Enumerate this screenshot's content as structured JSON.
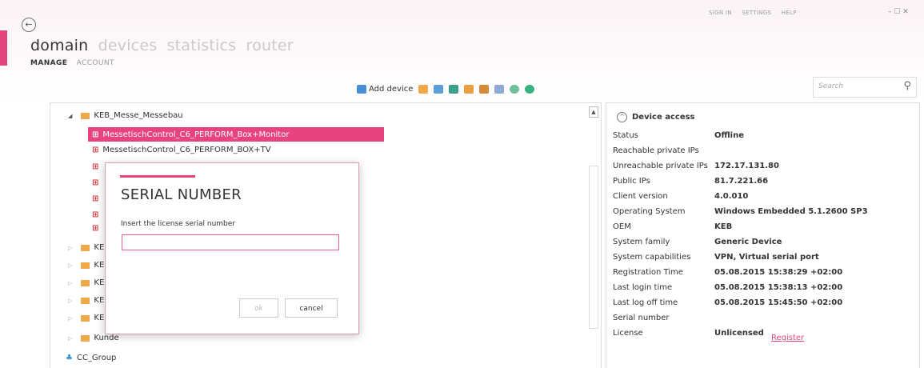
{
  "header": {
    "back_icon": "back-arrow-icon",
    "nav": [
      "domain",
      "devices",
      "statistics",
      "router"
    ],
    "subnav": [
      "MANAGE",
      "ACCOUNT"
    ],
    "top_links": [
      "SIGN IN",
      "SETTINGS",
      "HELP"
    ],
    "window_controls": "– ☐ ✕"
  },
  "toolbar": {
    "add_device_label": "Add device",
    "icons": [
      "add-folder-icon",
      "add-user-group-icon",
      "users-icon",
      "folder-move-icon",
      "folder-share-icon",
      "grid-icon",
      "remote-icon",
      "refresh-icon"
    ]
  },
  "search": {
    "placeholder": "Search"
  },
  "tree": {
    "parent": "KEB_Messe_Messebau",
    "selected_device": "MessetischControl_C6_PERFORM_Box+Monitor",
    "device2": "MessetischControl_C6_PERFORM_BOX+TV",
    "folder_prefix": "KEB_",
    "kunde": "Kunde",
    "cc_group": "CC_Group"
  },
  "details": {
    "title": "Device access",
    "rows": [
      {
        "label": "Status",
        "value": "Offline"
      },
      {
        "label": "Reachable private IPs",
        "value": ""
      },
      {
        "label": "Unreachable private IPs",
        "value": "172.17.131.80"
      },
      {
        "label": "Public IPs",
        "value": "81.7.221.66"
      },
      {
        "label": "Client version",
        "value": "4.0.010"
      },
      {
        "label": "Operating System",
        "value": "Windows Embedded 5.1.2600 SP3"
      },
      {
        "label": "OEM",
        "value": "KEB"
      },
      {
        "label": "System family",
        "value": "Generic Device"
      },
      {
        "label": "System capabilities",
        "value": "VPN, Virtual serial port"
      },
      {
        "label": "Registration Time",
        "value": "05.08.2015 15:38:29 +02:00"
      },
      {
        "label": "Last login time",
        "value": "05.08.2015 15:38:13 +02:00"
      },
      {
        "label": "Last log off time",
        "value": "05.08.2015 15:45:50 +02:00"
      },
      {
        "label": "Serial number",
        "value": ""
      },
      {
        "label": "License",
        "value": "Unlicensed"
      }
    ],
    "register_link": "Register"
  },
  "modal": {
    "title": "SERIAL NUMBER",
    "label": "Insert the license serial number",
    "input_value": "",
    "ok_label": "ok",
    "cancel_label": "cancel"
  }
}
